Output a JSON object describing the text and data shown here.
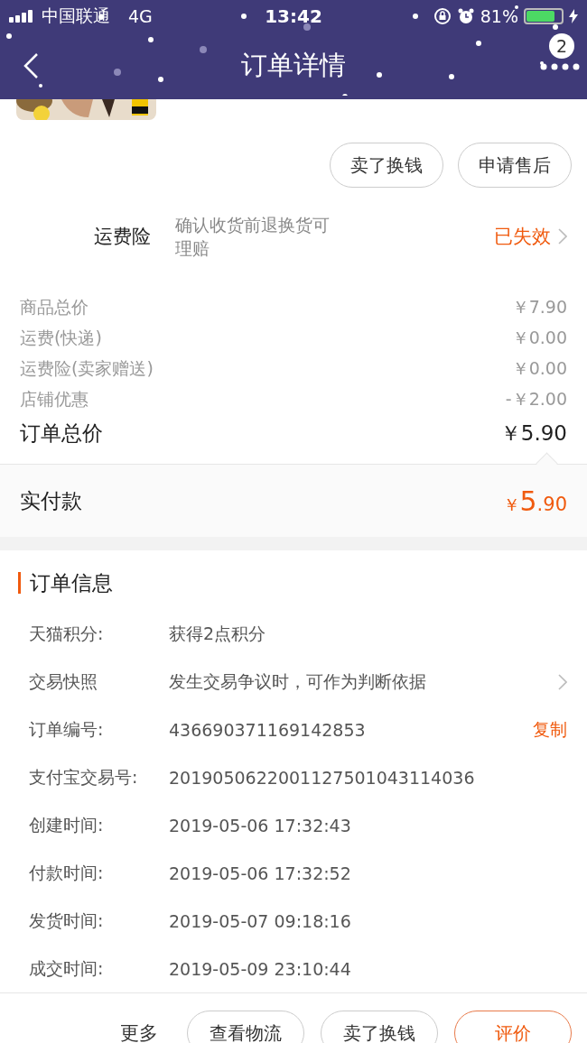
{
  "status_bar": {
    "carrier": "中国联通",
    "network": "4G",
    "time": "13:42",
    "battery": "81%"
  },
  "nav": {
    "title": "订单详情",
    "badge": "2"
  },
  "product": {
    "kind": "picture"
  },
  "top_actions": [
    "卖了换钱",
    "申请售后"
  ],
  "insurance": {
    "label": "运费险",
    "description": "确认收货前退换货可理赔",
    "status": "已失效"
  },
  "price_rows": [
    {
      "label": "商品总价",
      "value": "￥7.90"
    },
    {
      "label": "运费(快递)",
      "value": "￥0.00"
    },
    {
      "label": "运费险(卖家赠送)",
      "value": "￥0.00"
    },
    {
      "label": "店铺优惠",
      "value": "-￥2.00"
    }
  ],
  "order_total": {
    "label": "订单总价",
    "value": "￥5.90"
  },
  "paid": {
    "label": "实付款",
    "currency": "￥",
    "integer": "5",
    "decimal": ".90"
  },
  "order_info": {
    "title": "订单信息",
    "rows": [
      {
        "label": "天猫积分:",
        "value": "获得2点积分"
      },
      {
        "label": "交易快照",
        "value": "发生交易争议时，可作为判断依据",
        "kind": "link"
      },
      {
        "label": "订单编号:",
        "value": "436690371169142853",
        "action": "复制",
        "kind": "copy"
      },
      {
        "label": "支付宝交易号:",
        "value": "2019050622001127501043114036"
      },
      {
        "label": "创建时间:",
        "value": "2019-05-06 17:32:43"
      },
      {
        "label": "付款时间:",
        "value": "2019-05-06 17:32:52"
      },
      {
        "label": "发货时间:",
        "value": "2019-05-07 09:18:16"
      },
      {
        "label": "成交时间:",
        "value": "2019-05-09 23:10:44"
      }
    ]
  },
  "bottom_bar": {
    "more": "更多",
    "buttons": [
      {
        "label": "查看物流",
        "kind": "plain"
      },
      {
        "label": "卖了换钱",
        "kind": "plain"
      },
      {
        "label": "评价",
        "kind": "primary"
      }
    ]
  }
}
